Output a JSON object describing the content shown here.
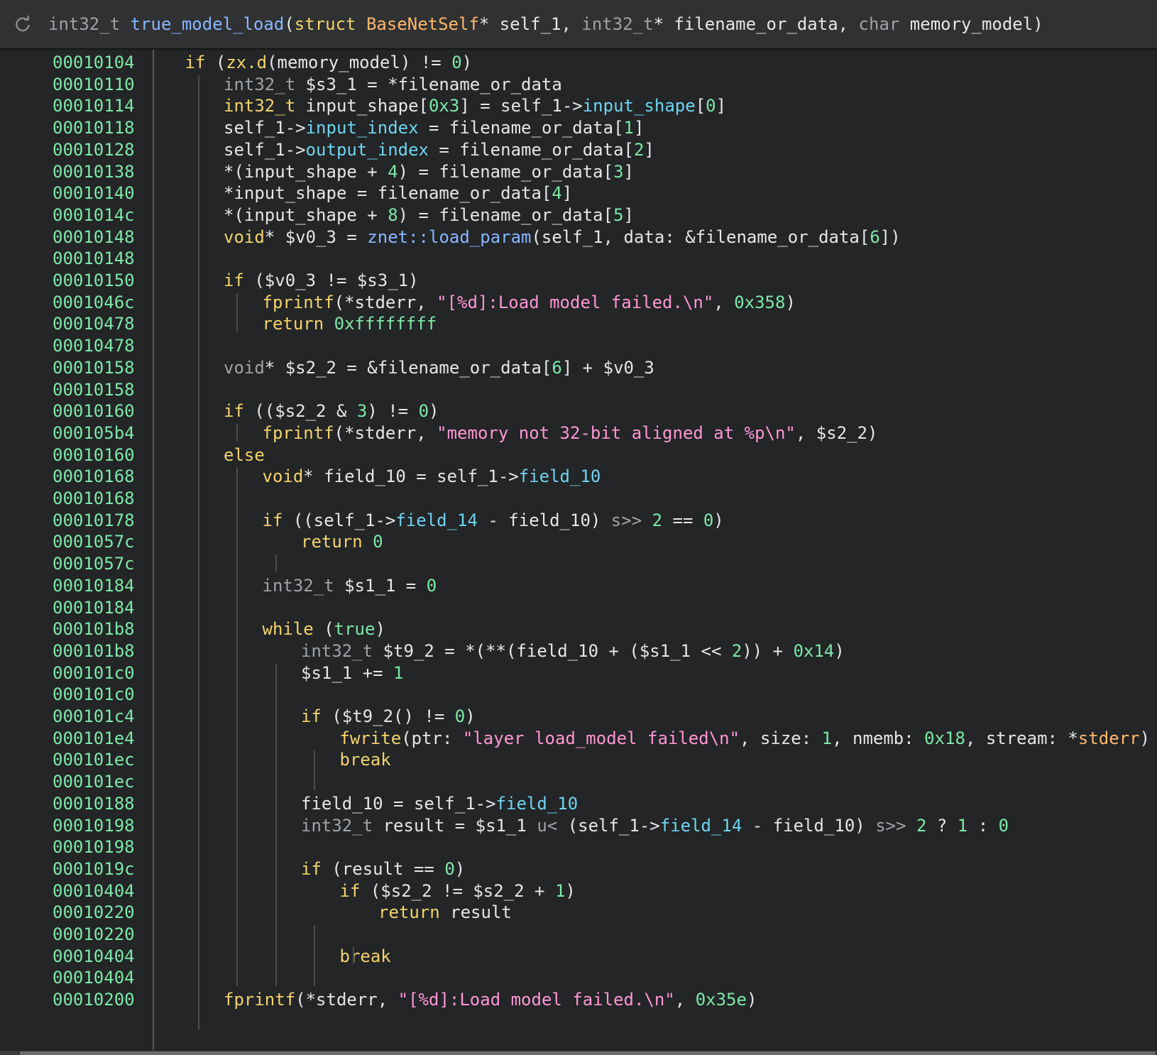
{
  "header": {
    "icon": "refresh-icon",
    "signature": [
      {
        "t": "int32_t ",
        "c": "ty"
      },
      {
        "t": "true_model_load",
        "c": "fn"
      },
      {
        "t": "(",
        "c": "par"
      },
      {
        "t": "struct ",
        "c": "kw"
      },
      {
        "t": "BaseNetSelf",
        "c": "st"
      },
      {
        "t": "* self_1, ",
        "c": "var"
      },
      {
        "t": "int32_t",
        "c": "ty"
      },
      {
        "t": "* filename_or_data, ",
        "c": "var"
      },
      {
        "t": "char ",
        "c": "ty"
      },
      {
        "t": "memory_model",
        "c": "var"
      },
      {
        "t": ")",
        "c": "par"
      }
    ]
  },
  "lines": [
    {
      "addr": "00010104",
      "indent": 1,
      "tokens": [
        {
          "t": "if ",
          "c": "kw"
        },
        {
          "t": "(",
          "c": "par"
        },
        {
          "t": "zx.d",
          "c": "kw"
        },
        {
          "t": "(memory_model) != ",
          "c": "var"
        },
        {
          "t": "0",
          "c": "num"
        },
        {
          "t": ")",
          "c": "par"
        }
      ]
    },
    {
      "addr": "00010110",
      "indent": 2,
      "tokens": [
        {
          "t": "int32_t ",
          "c": "ty"
        },
        {
          "t": "$s3_1 = *filename_or_data",
          "c": "var"
        }
      ]
    },
    {
      "addr": "00010114",
      "indent": 2,
      "tokens": [
        {
          "t": "int32_t ",
          "c": "kw"
        },
        {
          "t": "input_shape[",
          "c": "var"
        },
        {
          "t": "0x3",
          "c": "num"
        },
        {
          "t": "] = self_1->",
          "c": "var"
        },
        {
          "t": "input_shape",
          "c": "fld"
        },
        {
          "t": "[",
          "c": "var"
        },
        {
          "t": "0",
          "c": "num"
        },
        {
          "t": "]",
          "c": "var"
        }
      ]
    },
    {
      "addr": "00010118",
      "indent": 2,
      "tokens": [
        {
          "t": "self_1->",
          "c": "var"
        },
        {
          "t": "input_index",
          "c": "fld"
        },
        {
          "t": " = filename_or_data[",
          "c": "var"
        },
        {
          "t": "1",
          "c": "num"
        },
        {
          "t": "]",
          "c": "var"
        }
      ]
    },
    {
      "addr": "00010128",
      "indent": 2,
      "tokens": [
        {
          "t": "self_1->",
          "c": "var"
        },
        {
          "t": "output_index",
          "c": "fld"
        },
        {
          "t": " = filename_or_data[",
          "c": "var"
        },
        {
          "t": "2",
          "c": "num"
        },
        {
          "t": "]",
          "c": "var"
        }
      ]
    },
    {
      "addr": "00010138",
      "indent": 2,
      "tokens": [
        {
          "t": "*(input_shape + ",
          "c": "var"
        },
        {
          "t": "4",
          "c": "num"
        },
        {
          "t": ") = filename_or_data[",
          "c": "var"
        },
        {
          "t": "3",
          "c": "num"
        },
        {
          "t": "]",
          "c": "var"
        }
      ]
    },
    {
      "addr": "00010140",
      "indent": 2,
      "tokens": [
        {
          "t": "*input_shape = filename_or_data[",
          "c": "var"
        },
        {
          "t": "4",
          "c": "num"
        },
        {
          "t": "]",
          "c": "var"
        }
      ]
    },
    {
      "addr": "0001014c",
      "indent": 2,
      "tokens": [
        {
          "t": "*(input_shape + ",
          "c": "var"
        },
        {
          "t": "8",
          "c": "num"
        },
        {
          "t": ") = filename_or_data[",
          "c": "var"
        },
        {
          "t": "5",
          "c": "num"
        },
        {
          "t": "]",
          "c": "var"
        }
      ]
    },
    {
      "addr": "00010148",
      "indent": 2,
      "tokens": [
        {
          "t": "void",
          "c": "kw"
        },
        {
          "t": "* $v0_3 = ",
          "c": "var"
        },
        {
          "t": "znet::load_param",
          "c": "fn"
        },
        {
          "t": "(self_1, data: &filename_or_data[",
          "c": "var"
        },
        {
          "t": "6",
          "c": "num"
        },
        {
          "t": "])",
          "c": "var"
        }
      ]
    },
    {
      "addr": "00010148",
      "indent": 2,
      "tokens": []
    },
    {
      "addr": "00010150",
      "indent": 2,
      "tokens": [
        {
          "t": "if ",
          "c": "kw"
        },
        {
          "t": "($v0_3 != $s3_1)",
          "c": "var"
        }
      ]
    },
    {
      "addr": "0001046c",
      "indent": 3,
      "tokens": [
        {
          "t": "fprintf",
          "c": "kw"
        },
        {
          "t": "(*stderr, ",
          "c": "var"
        },
        {
          "t": "\"[%d]:Load model failed.\\n\"",
          "c": "str"
        },
        {
          "t": ", ",
          "c": "var"
        },
        {
          "t": "0x358",
          "c": "num"
        },
        {
          "t": ")",
          "c": "var"
        }
      ]
    },
    {
      "addr": "00010478",
      "indent": 3,
      "tokens": [
        {
          "t": "return ",
          "c": "kw"
        },
        {
          "t": "0xffffffff",
          "c": "num"
        }
      ]
    },
    {
      "addr": "00010478",
      "indent": 2,
      "tokens": []
    },
    {
      "addr": "00010158",
      "indent": 2,
      "tokens": [
        {
          "t": "void",
          "c": "ty"
        },
        {
          "t": "* $s2_2 = &filename_or_data[",
          "c": "var"
        },
        {
          "t": "6",
          "c": "num"
        },
        {
          "t": "] + $v0_3",
          "c": "var"
        }
      ]
    },
    {
      "addr": "00010158",
      "indent": 2,
      "tokens": []
    },
    {
      "addr": "00010160",
      "indent": 2,
      "tokens": [
        {
          "t": "if ",
          "c": "kw"
        },
        {
          "t": "(($s2_2 & ",
          "c": "var"
        },
        {
          "t": "3",
          "c": "num"
        },
        {
          "t": ") != ",
          "c": "var"
        },
        {
          "t": "0",
          "c": "num"
        },
        {
          "t": ")",
          "c": "var"
        }
      ]
    },
    {
      "addr": "000105b4",
      "indent": 3,
      "tokens": [
        {
          "t": "fprintf",
          "c": "kw"
        },
        {
          "t": "(*stderr, ",
          "c": "var"
        },
        {
          "t": "\"memory not 32-bit aligned at %p\\n\"",
          "c": "str"
        },
        {
          "t": ", $s2_2)",
          "c": "var"
        }
      ]
    },
    {
      "addr": "00010160",
      "indent": 2,
      "tokens": [
        {
          "t": "else",
          "c": "kw"
        }
      ]
    },
    {
      "addr": "00010168",
      "indent": 3,
      "tokens": [
        {
          "t": "void",
          "c": "kw"
        },
        {
          "t": "* field_10 = self_1->",
          "c": "var"
        },
        {
          "t": "field_10",
          "c": "fld"
        }
      ]
    },
    {
      "addr": "00010168",
      "indent": 3,
      "tokens": []
    },
    {
      "addr": "00010178",
      "indent": 3,
      "tokens": [
        {
          "t": "if ",
          "c": "kw"
        },
        {
          "t": "((self_1->",
          "c": "var"
        },
        {
          "t": "field_14",
          "c": "fld"
        },
        {
          "t": " - field_10) ",
          "c": "var"
        },
        {
          "t": "s>> ",
          "c": "ty"
        },
        {
          "t": "2",
          "c": "num"
        },
        {
          "t": " == ",
          "c": "var"
        },
        {
          "t": "0",
          "c": "num"
        },
        {
          "t": ")",
          "c": "var"
        }
      ]
    },
    {
      "addr": "0001057c",
      "indent": 4,
      "tokens": [
        {
          "t": "return ",
          "c": "kw"
        },
        {
          "t": "0",
          "c": "num"
        }
      ]
    },
    {
      "addr": "0001057c",
      "indent": 3,
      "tokens": []
    },
    {
      "addr": "00010184",
      "indent": 3,
      "tokens": [
        {
          "t": "int32_t ",
          "c": "ty"
        },
        {
          "t": "$s1_1 = ",
          "c": "var"
        },
        {
          "t": "0",
          "c": "num"
        }
      ]
    },
    {
      "addr": "00010184",
      "indent": 3,
      "tokens": []
    },
    {
      "addr": "000101b8",
      "indent": 3,
      "tokens": [
        {
          "t": "while ",
          "c": "kw"
        },
        {
          "t": "(",
          "c": "var"
        },
        {
          "t": "true",
          "c": "num"
        },
        {
          "t": ")",
          "c": "var"
        }
      ]
    },
    {
      "addr": "000101b8",
      "indent": 4,
      "tokens": [
        {
          "t": "int32_t ",
          "c": "ty"
        },
        {
          "t": "$t9_2 = *(**(field_10 + ($s1_1 << ",
          "c": "var"
        },
        {
          "t": "2",
          "c": "num"
        },
        {
          "t": ")) + ",
          "c": "var"
        },
        {
          "t": "0x14",
          "c": "num"
        },
        {
          "t": ")",
          "c": "var"
        }
      ]
    },
    {
      "addr": "000101c0",
      "indent": 4,
      "tokens": [
        {
          "t": "$s1_1 += ",
          "c": "var"
        },
        {
          "t": "1",
          "c": "num"
        }
      ]
    },
    {
      "addr": "000101c0",
      "indent": 4,
      "tokens": []
    },
    {
      "addr": "000101c4",
      "indent": 4,
      "tokens": [
        {
          "t": "if ",
          "c": "kw"
        },
        {
          "t": "($t9_2() != ",
          "c": "var"
        },
        {
          "t": "0",
          "c": "num"
        },
        {
          "t": ")",
          "c": "var"
        }
      ]
    },
    {
      "addr": "000101e4",
      "indent": 5,
      "tokens": [
        {
          "t": "fwrite",
          "c": "kw"
        },
        {
          "t": "(ptr: ",
          "c": "var"
        },
        {
          "t": "\"layer load_model failed\\n\"",
          "c": "str"
        },
        {
          "t": ", size: ",
          "c": "var"
        },
        {
          "t": "1",
          "c": "num"
        },
        {
          "t": ", nmemb: ",
          "c": "var"
        },
        {
          "t": "0x18",
          "c": "num"
        },
        {
          "t": ", stream: *",
          "c": "var"
        },
        {
          "t": "stderr",
          "c": "st"
        },
        {
          "t": ")",
          "c": "var"
        }
      ]
    },
    {
      "addr": "000101ec",
      "indent": 5,
      "tokens": [
        {
          "t": "break",
          "c": "kw"
        }
      ]
    },
    {
      "addr": "000101ec",
      "indent": 4,
      "tokens": []
    },
    {
      "addr": "00010188",
      "indent": 4,
      "tokens": [
        {
          "t": "field_10 = self_1->",
          "c": "var"
        },
        {
          "t": "field_10",
          "c": "fld"
        }
      ]
    },
    {
      "addr": "00010198",
      "indent": 4,
      "tokens": [
        {
          "t": "int32_t ",
          "c": "ty"
        },
        {
          "t": "result = $s1_1 ",
          "c": "var"
        },
        {
          "t": "u< ",
          "c": "ty"
        },
        {
          "t": "(self_1->",
          "c": "var"
        },
        {
          "t": "field_14",
          "c": "fld"
        },
        {
          "t": " - field_10) ",
          "c": "var"
        },
        {
          "t": "s>> ",
          "c": "ty"
        },
        {
          "t": "2",
          "c": "num"
        },
        {
          "t": " ? ",
          "c": "var"
        },
        {
          "t": "1",
          "c": "num"
        },
        {
          "t": " : ",
          "c": "var"
        },
        {
          "t": "0",
          "c": "num"
        }
      ]
    },
    {
      "addr": "00010198",
      "indent": 4,
      "tokens": []
    },
    {
      "addr": "0001019c",
      "indent": 4,
      "tokens": [
        {
          "t": "if ",
          "c": "kw"
        },
        {
          "t": "(result == ",
          "c": "var"
        },
        {
          "t": "0",
          "c": "num"
        },
        {
          "t": ")",
          "c": "var"
        }
      ]
    },
    {
      "addr": "00010404",
      "indent": 5,
      "tokens": [
        {
          "t": "if ",
          "c": "kw"
        },
        {
          "t": "($s2_2 != $s2_2 + ",
          "c": "var"
        },
        {
          "t": "1",
          "c": "num"
        },
        {
          "t": ")",
          "c": "var"
        }
      ]
    },
    {
      "addr": "00010220",
      "indent": 6,
      "tokens": [
        {
          "t": "return ",
          "c": "kw"
        },
        {
          "t": "result",
          "c": "var"
        }
      ]
    },
    {
      "addr": "00010220",
      "indent": 5,
      "tokens": []
    },
    {
      "addr": "00010404",
      "indent": 5,
      "tokens": [
        {
          "t": "break",
          "c": "kw"
        }
      ]
    },
    {
      "addr": "00010404",
      "indent": 2,
      "tokens": []
    },
    {
      "addr": "00010200",
      "indent": 2,
      "tokens": [
        {
          "t": "fprintf",
          "c": "kw"
        },
        {
          "t": "(*stderr, ",
          "c": "var"
        },
        {
          "t": "\"[%d]:Load model failed.\\n\"",
          "c": "str"
        },
        {
          "t": ", ",
          "c": "var"
        },
        {
          "t": "0x35e",
          "c": "num"
        },
        {
          "t": ")",
          "c": "var"
        }
      ]
    }
  ],
  "guides": [
    {
      "level": 1,
      "from": 1,
      "to": 44
    },
    {
      "level": 2,
      "from": 11,
      "to": 12
    },
    {
      "level": 2,
      "from": 17,
      "to": 17
    },
    {
      "level": 2,
      "from": 19,
      "to": 42
    },
    {
      "level": 3,
      "from": 23,
      "to": 23
    },
    {
      "level": 3,
      "from": 28,
      "to": 42
    },
    {
      "level": 4,
      "from": 32,
      "to": 33
    },
    {
      "level": 4,
      "from": 40,
      "to": 42
    },
    {
      "level": 5,
      "from": 41,
      "to": 41
    }
  ],
  "colors": {
    "keyword": "#f3d36c",
    "type": "#a0a3a6",
    "function": "#89b7ff",
    "struct": "#ffb86b",
    "string": "#ff96d4",
    "number": "#7fe8a8",
    "field": "#6fd4f0",
    "address": "#7fe8a8",
    "background": "#232527"
  }
}
